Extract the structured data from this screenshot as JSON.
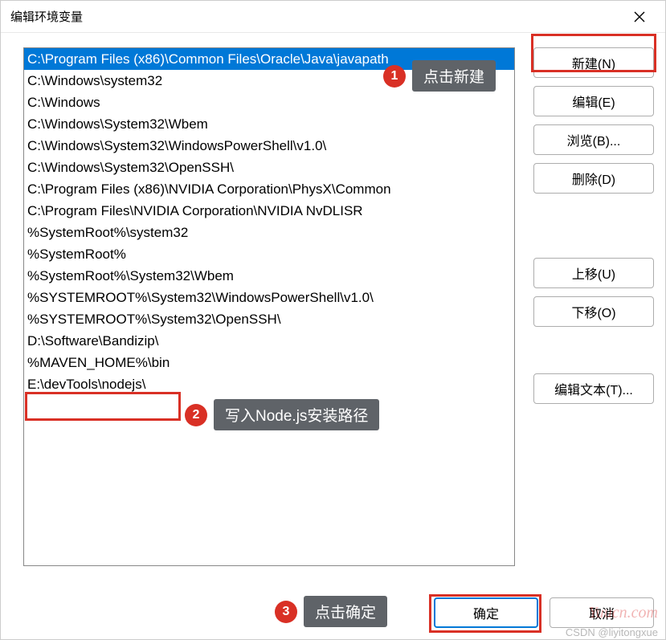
{
  "title": "编辑环境变量",
  "listItems": [
    "C:\\Program Files (x86)\\Common Files\\Oracle\\Java\\javapath",
    "C:\\Windows\\system32",
    "C:\\Windows",
    "C:\\Windows\\System32\\Wbem",
    "C:\\Windows\\System32\\WindowsPowerShell\\v1.0\\",
    "C:\\Windows\\System32\\OpenSSH\\",
    "C:\\Program Files (x86)\\NVIDIA Corporation\\PhysX\\Common",
    "C:\\Program Files\\NVIDIA Corporation\\NVIDIA NvDLISR",
    "%SystemRoot%\\system32",
    "%SystemRoot%",
    "%SystemRoot%\\System32\\Wbem",
    "%SYSTEMROOT%\\System32\\WindowsPowerShell\\v1.0\\",
    "%SYSTEMROOT%\\System32\\OpenSSH\\",
    "D:\\Software\\Bandizip\\",
    "%MAVEN_HOME%\\bin",
    "E:\\devTools\\nodejs\\"
  ],
  "selectedIndex": 0,
  "buttons": {
    "new": "新建(N)",
    "edit": "编辑(E)",
    "browse": "浏览(B)...",
    "delete": "删除(D)",
    "moveUp": "上移(U)",
    "moveDown": "下移(O)",
    "editText": "编辑文本(T)...",
    "ok": "确定",
    "cancel": "取消"
  },
  "annotations": {
    "step1": {
      "num": "1",
      "text": "点击新建"
    },
    "step2": {
      "num": "2",
      "text": "写入Node.js安装路径"
    },
    "step3": {
      "num": "3",
      "text": "点击确定"
    }
  },
  "watermark": "Yuucn.com",
  "attribution": "CSDN @liyitongxue"
}
